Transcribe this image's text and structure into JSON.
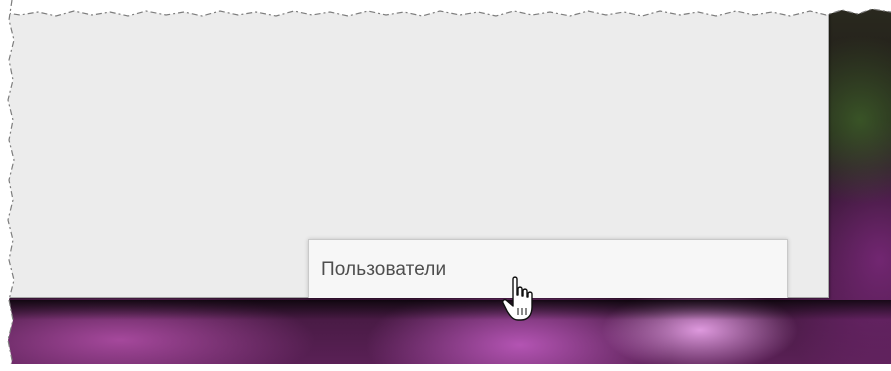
{
  "menu": {
    "items": [
      {
        "label": "Пользователи",
        "state": "hover"
      }
    ]
  },
  "pointer": {
    "icon": "hand-pointer-icon"
  },
  "colors": {
    "panel_background": "#ececec",
    "menu_background": "#f7f7f7",
    "menu_text": "#4e4e4e",
    "wallpaper_accent": "#b45ab4"
  }
}
